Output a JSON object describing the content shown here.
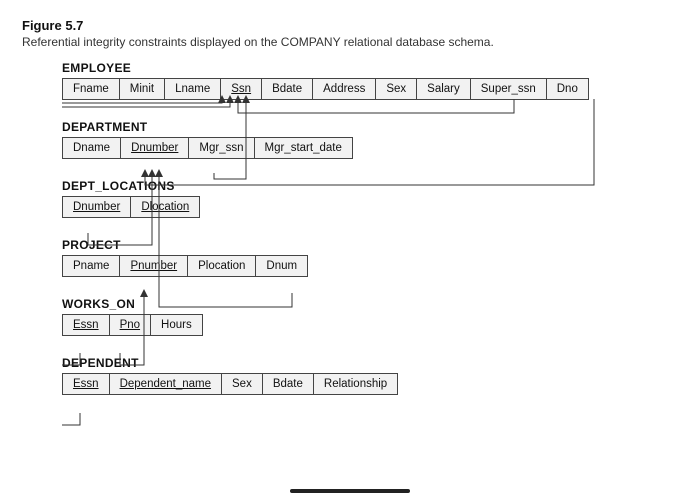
{
  "figure": {
    "label": "Figure 5.7",
    "caption": "Referential integrity constraints displayed on the COMPANY relational database schema."
  },
  "schema": {
    "tables": [
      {
        "name": "EMPLOYEE",
        "columns": [
          {
            "label": "Fname",
            "pk": false
          },
          {
            "label": "Minit",
            "pk": false
          },
          {
            "label": "Lname",
            "pk": false
          },
          {
            "label": "Ssn",
            "pk": true
          },
          {
            "label": "Bdate",
            "pk": false
          },
          {
            "label": "Address",
            "pk": false
          },
          {
            "label": "Sex",
            "pk": false
          },
          {
            "label": "Salary",
            "pk": false
          },
          {
            "label": "Super_ssn",
            "pk": false
          },
          {
            "label": "Dno",
            "pk": false
          }
        ]
      },
      {
        "name": "DEPARTMENT",
        "columns": [
          {
            "label": "Dname",
            "pk": false
          },
          {
            "label": "Dnumber",
            "pk": true
          },
          {
            "label": "Mgr_ssn",
            "pk": false
          },
          {
            "label": "Mgr_start_date",
            "pk": false
          }
        ]
      },
      {
        "name": "DEPT_LOCATIONS",
        "columns": [
          {
            "label": "Dnumber",
            "pk": true
          },
          {
            "label": "Dlocation",
            "pk": true
          }
        ]
      },
      {
        "name": "PROJECT",
        "columns": [
          {
            "label": "Pname",
            "pk": false
          },
          {
            "label": "Pnumber",
            "pk": true
          },
          {
            "label": "Plocation",
            "pk": false
          },
          {
            "label": "Dnum",
            "pk": false
          }
        ]
      },
      {
        "name": "WORKS_ON",
        "columns": [
          {
            "label": "Essn",
            "pk": true
          },
          {
            "label": "Pno",
            "pk": true
          },
          {
            "label": "Hours",
            "pk": false
          }
        ]
      },
      {
        "name": "DEPENDENT",
        "columns": [
          {
            "label": "Essn",
            "pk": true
          },
          {
            "label": "Dependent_name",
            "pk": true
          },
          {
            "label": "Sex",
            "pk": false
          },
          {
            "label": "Bdate",
            "pk": false
          },
          {
            "label": "Relationship",
            "pk": false
          }
        ]
      }
    ],
    "fk_constraints": [
      {
        "from": "EMPLOYEE.Super_ssn",
        "to": "EMPLOYEE.Ssn"
      },
      {
        "from": "EMPLOYEE.Dno",
        "to": "DEPARTMENT.Dnumber"
      },
      {
        "from": "DEPARTMENT.Mgr_ssn",
        "to": "EMPLOYEE.Ssn"
      },
      {
        "from": "DEPT_LOCATIONS.Dnumber",
        "to": "DEPARTMENT.Dnumber"
      },
      {
        "from": "PROJECT.Dnum",
        "to": "DEPARTMENT.Dnumber"
      },
      {
        "from": "WORKS_ON.Essn",
        "to": "EMPLOYEE.Ssn"
      },
      {
        "from": "WORKS_ON.Pno",
        "to": "PROJECT.Pnumber"
      },
      {
        "from": "DEPENDENT.Essn",
        "to": "EMPLOYEE.Ssn"
      }
    ]
  }
}
